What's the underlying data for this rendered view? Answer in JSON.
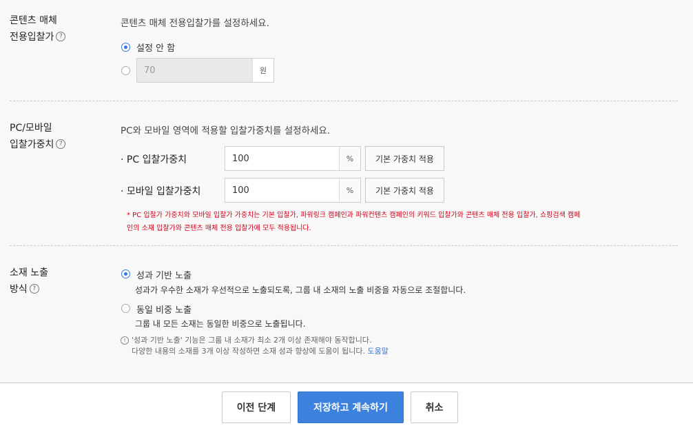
{
  "content_bid": {
    "title_line1": "콘텐츠 매체",
    "title_line2": "전용입찰가",
    "help_icon": "?",
    "description": "콘텐츠 매체 전용입찰가를 설정하세요.",
    "option_none_label": "설정 안 함",
    "option_none_selected": true,
    "amount_value": "70",
    "amount_unit": "원"
  },
  "weight": {
    "title_line1": "PC/모바일",
    "title_line2": "입찰가중치",
    "help_icon": "?",
    "description": "PC와 모바일 영역에 적용할 입찰가중치를 설정하세요.",
    "pc_label": "· PC 입찰가중치",
    "pc_value": "100",
    "mobile_label": "· 모바일 입찰가중치",
    "mobile_value": "100",
    "unit": "%",
    "apply_default_label": "기본 가중치 적용",
    "note_line1": "* PC 입찰가 가중치와 모바일 입찰가 가중치는 기본 입찰가, 파워링크 캠페인과 파워컨텐츠 캠페인의 키워드 입찰가와 콘텐츠 매체 전용 입찰가, 쇼핑검색 캠페",
    "note_line2": "인의 소재 입찰가와 콘텐츠 매체 전용 입찰가에 모두 적용됩니다."
  },
  "exposure": {
    "title_line1": "소재 노출",
    "title_line2": "방식",
    "help_icon": "?",
    "option_performance_label": "성과 기반 노출",
    "option_performance_desc": "성과가 우수한 소재가 우선적으로 노출되도록, 그룹 내 소재의 노출 비중을 자동으로 조절합니다.",
    "option_performance_selected": true,
    "option_equal_label": "동일 비중 노출",
    "option_equal_desc": "그룹 내 모든 소재는 동일한 비중으로 노출됩니다.",
    "info_icon": "!",
    "info_line1": "'성과 기반 노출' 기능은 그룹 내 소재가 최소 2개 이상 존재해야 동작합니다.",
    "info_line2": "다양한 내용의 소재를 3개 이상 작성하면 소재 성과 향상에 도움이 됩니다.",
    "help_link": "도움말"
  },
  "footer": {
    "prev_label": "이전 단계",
    "save_label": "저장하고 계속하기",
    "cancel_label": "취소"
  },
  "colors": {
    "accent": "#3c82dc",
    "note_red": "#d0021b"
  }
}
